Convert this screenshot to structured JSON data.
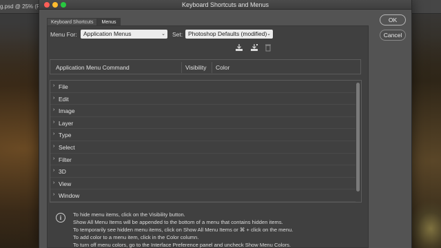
{
  "background": {
    "document_tab": "g.psd @ 25% (R"
  },
  "dialog": {
    "title": "Keyboard Shortcuts and Menus",
    "tabs": [
      {
        "label": "Keyboard Shortcuts",
        "active": false
      },
      {
        "label": "Menus",
        "active": true
      }
    ],
    "menu_for": {
      "label": "Menu For:",
      "value": "Application Menus"
    },
    "set": {
      "label": "Set:",
      "value": "Photoshop Defaults (modified)"
    },
    "toolbar_icons": [
      "save-set-icon",
      "save-set-as-icon",
      "delete-set-icon"
    ],
    "table": {
      "columns": [
        "Application Menu Command",
        "Visibility",
        "Color"
      ],
      "rows": [
        "File",
        "Edit",
        "Image",
        "Layer",
        "Type",
        "Select",
        "Filter",
        "3D",
        "View",
        "Window"
      ]
    },
    "info": [
      "To hide menu items, click on the Visibility button.",
      "Show All Menu Items will be appended to the bottom of a menu that contains hidden items.",
      "To temporarily see hidden menu items, click on Show All Menu Items or ⌘ + click on the menu.",
      "To add color to a menu item, click in the Color column.",
      "To turn off menu colors, go to the Interface Preference panel and uncheck Show Menu Colors."
    ],
    "buttons": {
      "ok": "OK",
      "cancel": "Cancel"
    }
  },
  "colors": {
    "dialog_bg": "#535353",
    "panel_bg": "#404040",
    "dropdown_bg": "#ececec",
    "close": "#ff5f57",
    "minimize": "#febc2e",
    "maximize": "#28c840"
  }
}
